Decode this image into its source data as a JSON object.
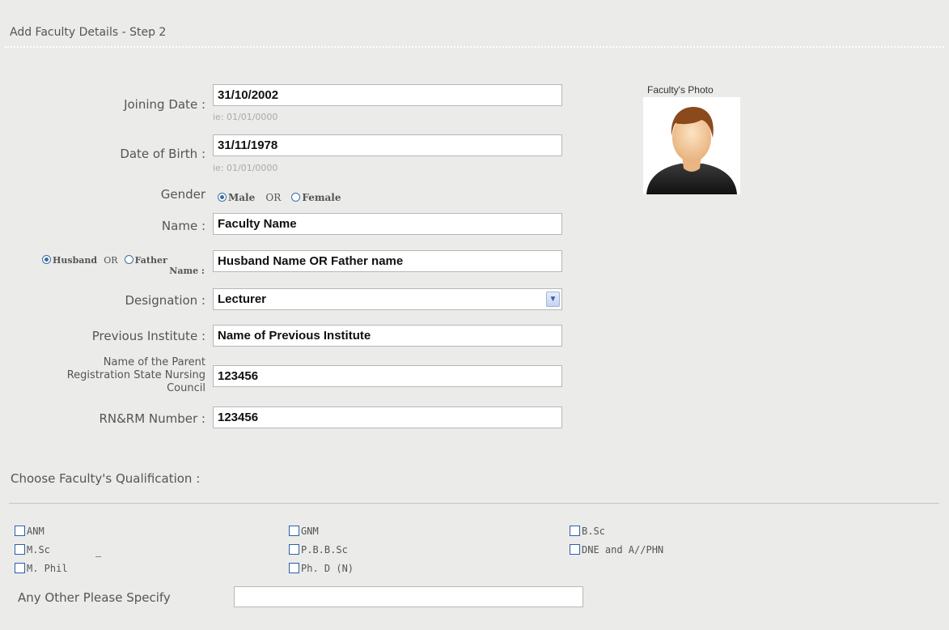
{
  "header": {
    "title": "Add Faculty Details  - Step 2"
  },
  "form": {
    "joining_date": {
      "label": "Joining Date :",
      "value": "31/10/2002",
      "hint": "ie: 01/01/0000"
    },
    "dob": {
      "label": "Date of Birth :",
      "value": "31/11/1978",
      "hint": "ie: 01/01/0000"
    },
    "gender": {
      "label": "Gender",
      "opt_male": "Male",
      "or": "OR",
      "opt_female": "Female",
      "selected": "Male"
    },
    "name": {
      "label": "Name :",
      "value": "Faculty Name"
    },
    "relation": {
      "opt_husband": "Husband",
      "or": "OR",
      "opt_father": "Father",
      "suffix": "Name :",
      "selected": "Husband",
      "value": "Husband Name OR Father name"
    },
    "designation": {
      "label": "Designation :",
      "value": "Lecturer"
    },
    "previous_institute": {
      "label": "Previous Institute :",
      "value": "Name of Previous Institute"
    },
    "council": {
      "label_lines": [
        "Name of the Parent",
        "Registration State Nursing",
        "Council"
      ],
      "value": "123456"
    },
    "rn_rm": {
      "label": "RN&RM Number :",
      "value": "123456"
    }
  },
  "photo": {
    "label": "Faculty's Photo"
  },
  "qualification": {
    "heading": "Choose Faculty's Qualification :",
    "options": [
      "ANM",
      "GNM",
      "B.Sc",
      "M.Sc",
      "P.B.B.Sc",
      "DNE and A//PHN",
      "M. Phil",
      "Ph. D (N)"
    ],
    "other_label": "Any Other Please Specify",
    "other_value": ""
  },
  "colors": {
    "panel_bg": "#ebebea",
    "radio_accent": "#3a6ea5",
    "checkbox_border": "#2d5fa8"
  }
}
